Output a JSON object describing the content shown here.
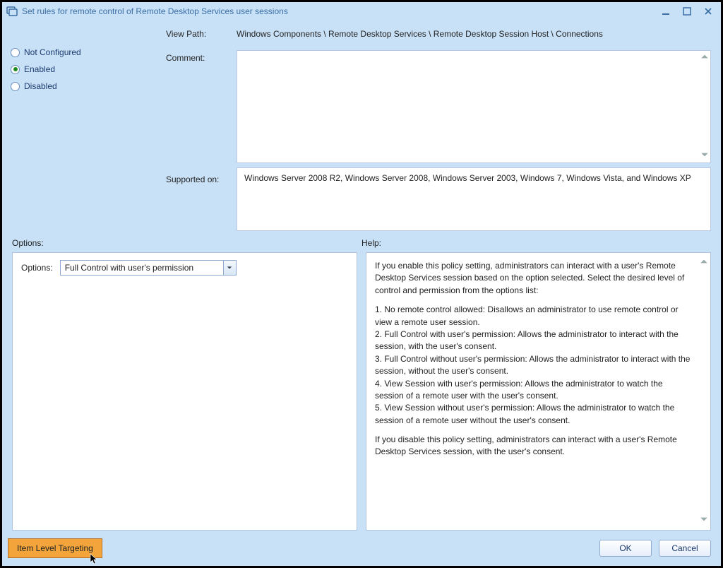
{
  "window": {
    "title": "Set rules for remote control of Remote Desktop Services user sessions"
  },
  "radios": {
    "not_configured": "Not Configured",
    "enabled": "Enabled",
    "disabled": "Disabled",
    "selected": "enabled"
  },
  "labels": {
    "view_path": "View Path:",
    "comment": "Comment:",
    "supported_on": "Supported on:",
    "options_heading": "Options:",
    "help_heading": "Help:",
    "options_field": "Options:"
  },
  "view_path_value": "Windows Components \\ Remote Desktop Services \\ Remote Desktop Session Host \\ Connections",
  "comment_value": "",
  "supported_on_value": "Windows Server 2008 R2, Windows Server 2008, Windows Server 2003, Windows 7, Windows Vista, and Windows XP",
  "options_combo": {
    "selected": "Full Control with user's permission"
  },
  "help": {
    "p1": "If you enable this policy setting, administrators can interact with a user's Remote Desktop Services session based on the option selected. Select the desired level of control and permission from the options list:",
    "l1": "1. No remote control allowed: Disallows an administrator to use remote control or view a remote user session.",
    "l2": "2. Full Control with user's permission: Allows the administrator to interact with the session, with the user's consent.",
    "l3": "3. Full Control without user's permission: Allows the administrator to interact with the session, without the user's consent.",
    "l4": "4. View Session with user's permission: Allows the administrator to watch the session of a remote user with the user's consent.",
    "l5": "5. View Session without user's permission: Allows the administrator to watch the session of a remote user without the user's consent.",
    "p2": "If you disable this policy setting, administrators can interact with a user's Remote Desktop Services session, with the user's consent."
  },
  "buttons": {
    "item_level_targeting": "Item Level Targeting",
    "ok": "OK",
    "cancel": "Cancel"
  }
}
